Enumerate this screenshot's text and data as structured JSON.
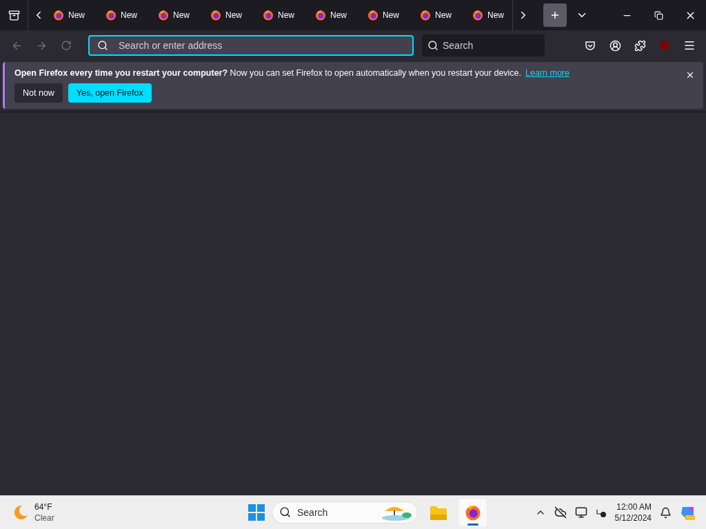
{
  "tabs": [
    {
      "label": "New",
      "selected": false
    },
    {
      "label": "New",
      "selected": false
    },
    {
      "label": "New",
      "selected": false
    },
    {
      "label": "New",
      "selected": false
    },
    {
      "label": "New",
      "selected": false
    },
    {
      "label": "New",
      "selected": false
    },
    {
      "label": "New",
      "selected": false
    },
    {
      "label": "New",
      "selected": false
    },
    {
      "label": "New",
      "selected": false
    }
  ],
  "address_bar": {
    "placeholder": "Search or enter address",
    "focused": true
  },
  "search_box": {
    "placeholder": "Search"
  },
  "notification": {
    "title": "Open Firefox every time you restart your computer?",
    "message": "Now you can set Firefox to open automatically when you restart your device.",
    "link": "Learn more",
    "buttons": [
      {
        "label": "Not now",
        "kind": "secondary"
      },
      {
        "label": "Yes, open Firefox",
        "kind": "primary"
      }
    ]
  },
  "taskbar": {
    "weather": {
      "temperature": "64°F",
      "condition": "Clear"
    },
    "search": {
      "placeholder": "Search"
    },
    "apps": [
      {
        "kind": "explorer",
        "active": false
      },
      {
        "kind": "firefox",
        "active": true
      }
    ],
    "clock": {
      "time": "12:00 AM",
      "date": "5/12/2024"
    }
  }
}
